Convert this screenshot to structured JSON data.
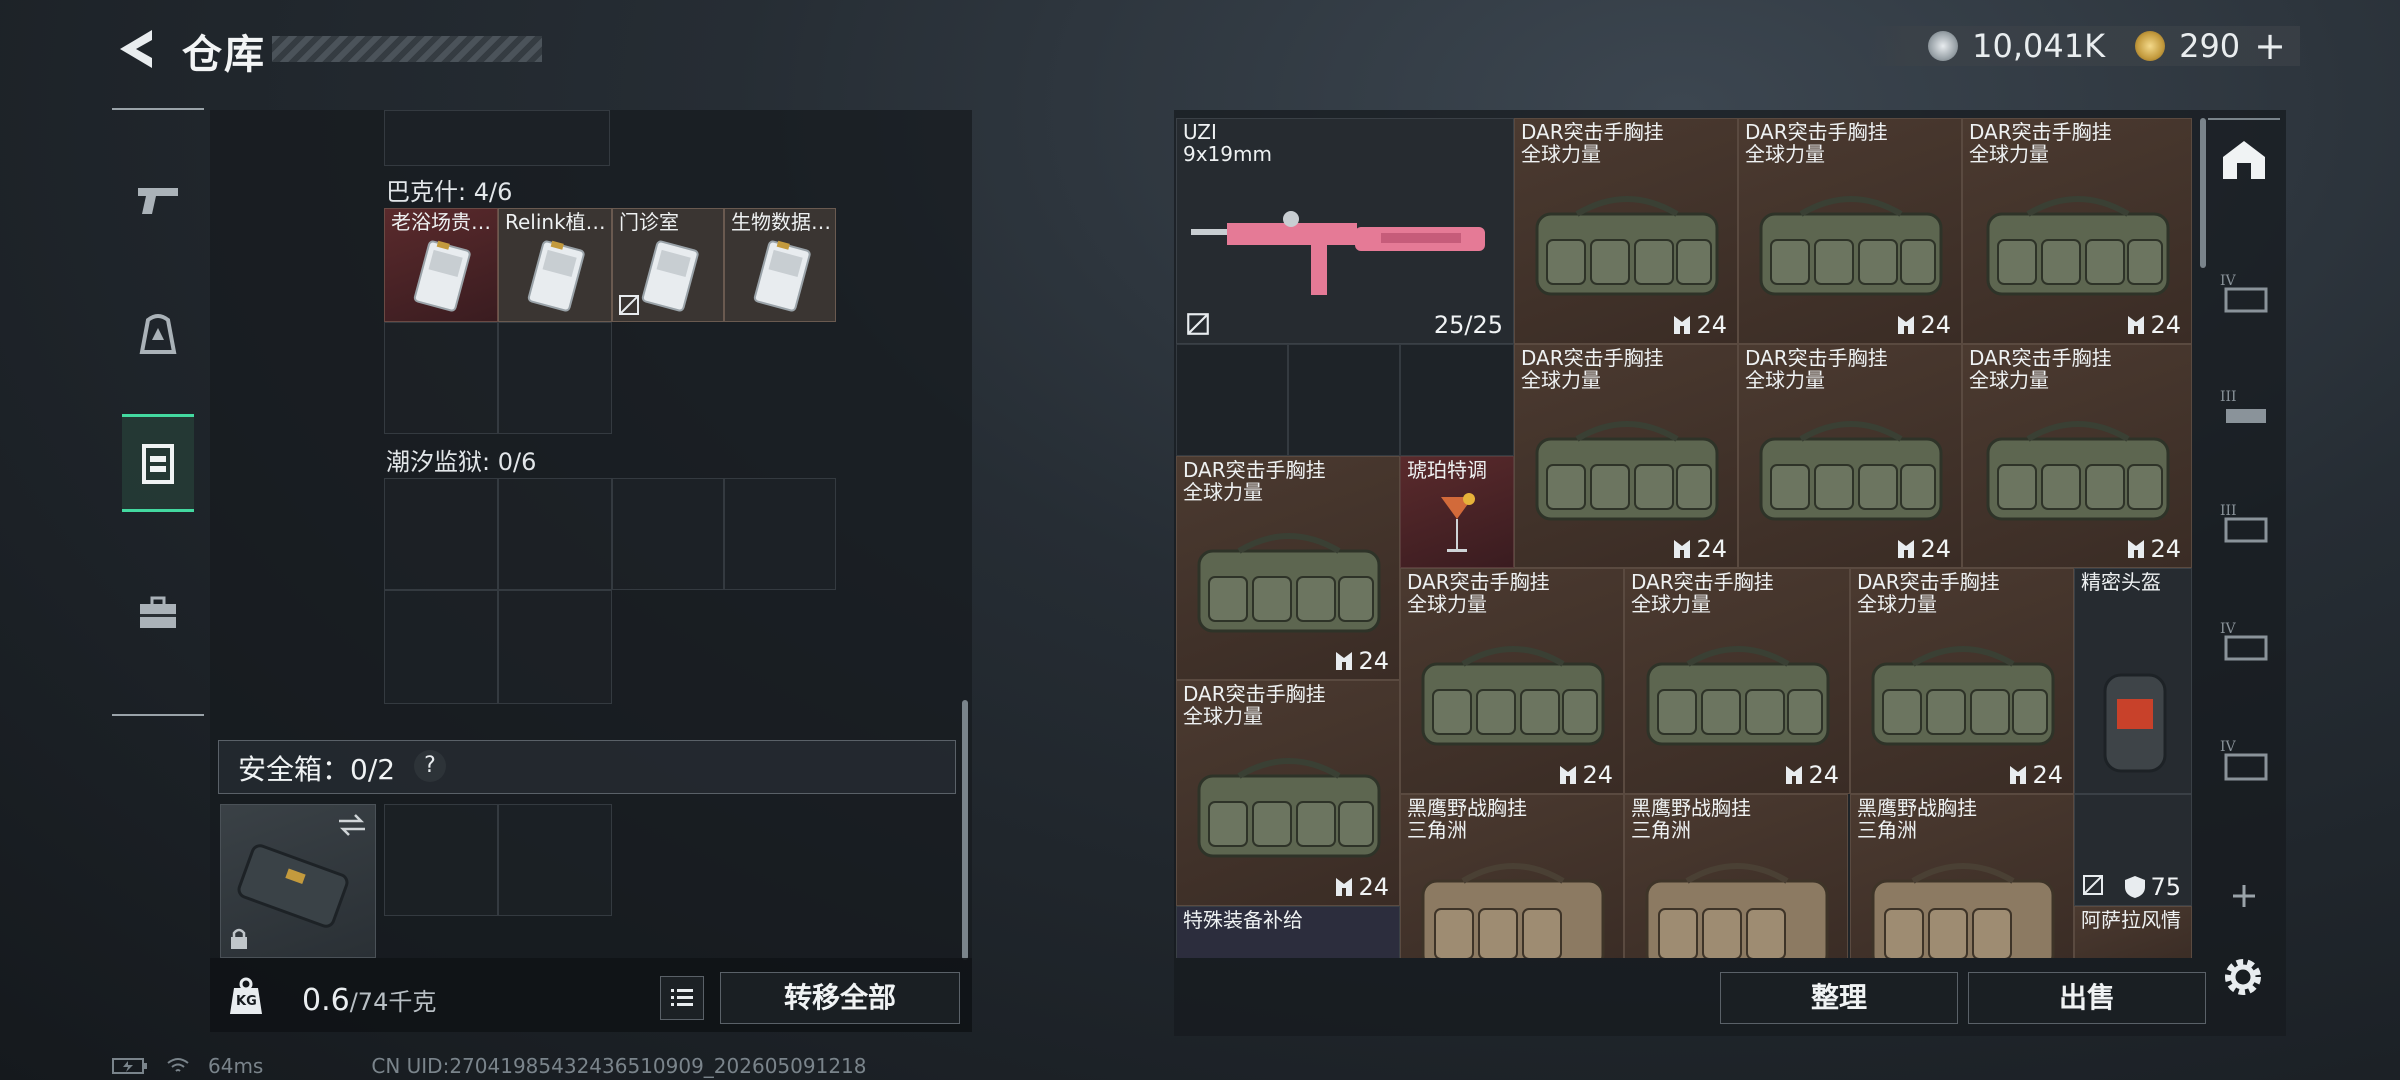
{
  "header": {
    "title": "仓库",
    "currency1": "10,041K",
    "currency2": "290",
    "add_symbol": "+"
  },
  "left_nav": [
    {
      "icon": "pistol-icon"
    },
    {
      "icon": "backpack-icon"
    },
    {
      "icon": "chest-rig-icon",
      "active": true
    },
    {
      "icon": "toolbox-icon"
    }
  ],
  "containers": {
    "bakeshi_label": "巴克什: 4/6",
    "bakeshi_items": [
      {
        "name": "老浴场贵…"
      },
      {
        "name": "Relink植…"
      },
      {
        "name": "门诊室"
      },
      {
        "name": "生物数据…"
      }
    ],
    "chaoxi_label": "潮汐监狱: 0/6"
  },
  "safe_box": {
    "label": "安全箱：0/2",
    "help": "?"
  },
  "bottom_left": {
    "kg_label": "KG",
    "weight_current": "0.6",
    "weight_max": "/74千克",
    "transfer_all": "转移全部"
  },
  "stash": {
    "uzi": {
      "name": "UZI",
      "ammo": "9x19mm",
      "count": "25/25"
    },
    "rig_name": "DAR突击手胸挂",
    "rig_brand": "全球力量",
    "rig_count": "24",
    "cocktail": "琥珀特调",
    "helmet": "精密头盔",
    "eagle_name": "黑鹰野战胸挂",
    "eagle_brand": "三角洲",
    "armor_value": "75",
    "special_supply": "特殊装备补给",
    "asala": "阿萨拉风情"
  },
  "bottom_right": {
    "sort": "整理",
    "sell": "出售"
  },
  "right_nav": [
    "home-icon",
    "tier-iv-icon",
    "tier-iii-icon",
    "tier-iii-icon",
    "tier-iv-icon",
    "tier-iv-icon"
  ],
  "status": {
    "ping": "64ms",
    "uid": "CN UID:27041985432436510909_202605091218"
  }
}
